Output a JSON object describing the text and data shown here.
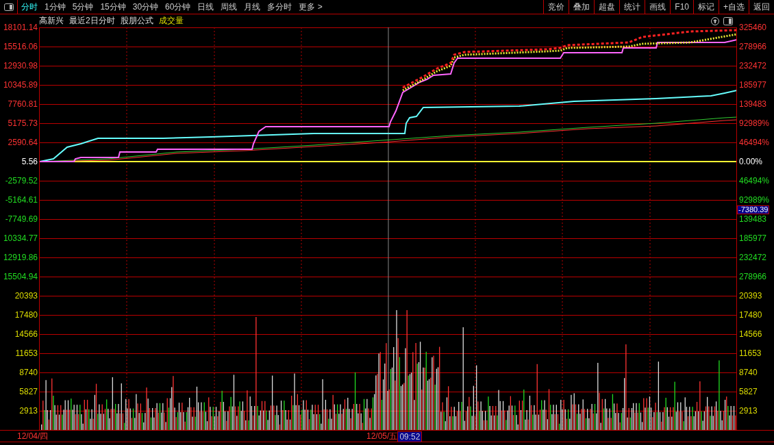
{
  "toolbar": {
    "tabs": [
      {
        "label": "分时",
        "selected": true
      },
      {
        "label": "1分钟",
        "selected": false
      },
      {
        "label": "5分钟",
        "selected": false
      },
      {
        "label": "15分钟",
        "selected": false
      },
      {
        "label": "30分钟",
        "selected": false
      },
      {
        "label": "60分钟",
        "selected": false
      },
      {
        "label": "日线",
        "selected": false
      },
      {
        "label": "周线",
        "selected": false
      },
      {
        "label": "月线",
        "selected": false
      },
      {
        "label": "多分时",
        "selected": false
      },
      {
        "label": "更多 >",
        "selected": false
      }
    ],
    "buttons": [
      "竞价",
      "叠加",
      "超盘",
      "统计",
      "画线",
      "F10",
      "标记",
      "+自选",
      "返回"
    ]
  },
  "info": {
    "stock": "高新兴",
    "period": "最近2日分时",
    "formula": "股朋公式",
    "indicator": "成交量"
  },
  "axis_left": [
    {
      "text": "18101.14",
      "kind": "up"
    },
    {
      "text": "15516.06",
      "kind": "up"
    },
    {
      "text": "12930.98",
      "kind": "up"
    },
    {
      "text": "10345.89",
      "kind": "up"
    },
    {
      "text": "7760.81",
      "kind": "up"
    },
    {
      "text": "5175.73",
      "kind": "up"
    },
    {
      "text": "2590.64",
      "kind": "up"
    },
    {
      "text": "5.56",
      "kind": "flat"
    },
    {
      "text": "-2579.52",
      "kind": "down"
    },
    {
      "text": "-5164.61",
      "kind": "down"
    },
    {
      "text": "-7749.69",
      "kind": "down"
    },
    {
      "text": "10334.77",
      "kind": "down"
    },
    {
      "text": "12919.86",
      "kind": "down"
    },
    {
      "text": "15504.94",
      "kind": "down"
    },
    {
      "text": "20393",
      "kind": "volume"
    },
    {
      "text": "17480",
      "kind": "volume"
    },
    {
      "text": "14566",
      "kind": "volume"
    },
    {
      "text": "11653",
      "kind": "volume"
    },
    {
      "text": "8740",
      "kind": "volume"
    },
    {
      "text": "5827",
      "kind": "volume"
    },
    {
      "text": "2913",
      "kind": "volume"
    }
  ],
  "axis_right": [
    {
      "text": "325460",
      "kind": "up"
    },
    {
      "text": "278966",
      "kind": "up"
    },
    {
      "text": "232472",
      "kind": "up"
    },
    {
      "text": "185977",
      "kind": "up"
    },
    {
      "text": "139483",
      "kind": "up"
    },
    {
      "text": "92989%",
      "kind": "up"
    },
    {
      "text": "46494%",
      "kind": "up"
    },
    {
      "text": "0.00%",
      "kind": "flat"
    },
    {
      "text": "46494%",
      "kind": "down"
    },
    {
      "text": "92989%",
      "kind": "down"
    },
    {
      "text": "139483",
      "kind": "down"
    },
    {
      "text": "185977",
      "kind": "down"
    },
    {
      "text": "232472",
      "kind": "down"
    },
    {
      "text": "278966",
      "kind": "down"
    },
    {
      "text": "20393",
      "kind": "volume"
    },
    {
      "text": "17480",
      "kind": "volume"
    },
    {
      "text": "14566",
      "kind": "volume"
    },
    {
      "text": "11653",
      "kind": "volume"
    },
    {
      "text": "8740",
      "kind": "volume"
    },
    {
      "text": "5827",
      "kind": "volume"
    },
    {
      "text": "2913",
      "kind": "volume"
    }
  ],
  "crosshair": {
    "value": "-7380.39",
    "time": "09:52"
  },
  "dates": [
    "12/04/四",
    "12/05/五"
  ]
}
